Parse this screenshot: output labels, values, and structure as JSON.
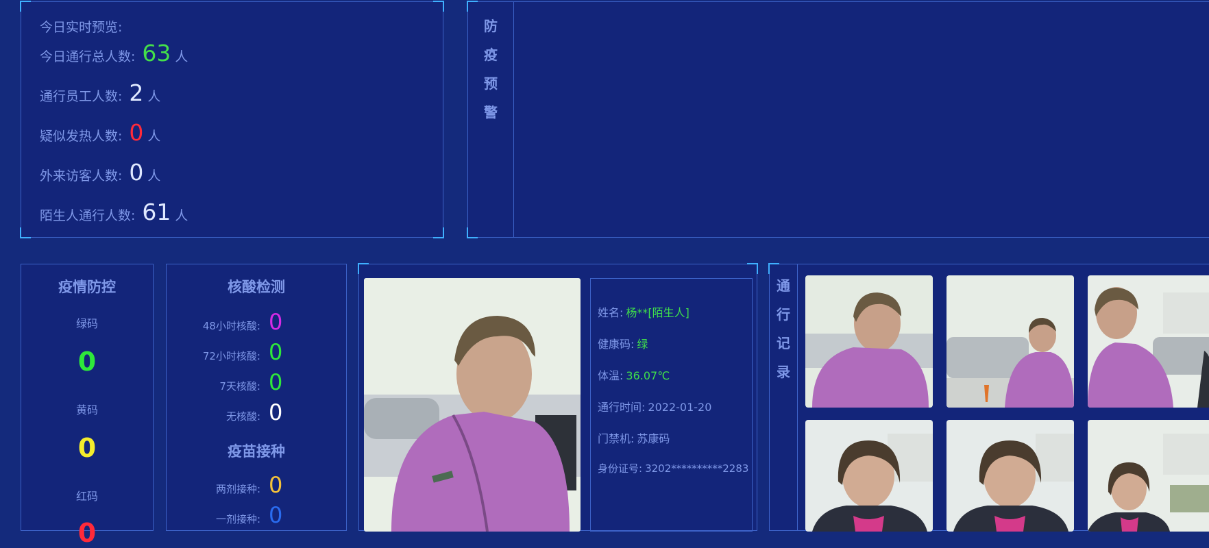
{
  "stats": {
    "title": "今日实时预览:",
    "rows": [
      {
        "label": "今日通行总人数:",
        "value": "63",
        "unit": "人",
        "color": "#44e04a"
      },
      {
        "label": "通行员工人数:",
        "value": "2",
        "unit": "人",
        "color": "#dfe8ff"
      },
      {
        "label": "疑似发热人数:",
        "value": "0",
        "unit": "人",
        "color": "#ff2a3a"
      },
      {
        "label": "外来访客人数:",
        "value": "0",
        "unit": "人",
        "color": "#dfe8ff"
      },
      {
        "label": "陌生人通行人数:",
        "value": "61",
        "unit": "人",
        "color": "#dfe8ff"
      }
    ]
  },
  "warning": {
    "title_chars": [
      "防",
      "疫",
      "预",
      "警"
    ]
  },
  "epidemic": {
    "title": "疫情防控",
    "codes": [
      {
        "label": "绿码",
        "value": "0",
        "color": "#2ee83a"
      },
      {
        "label": "黄码",
        "value": "0",
        "color": "#f4ec2c"
      },
      {
        "label": "红码",
        "value": "0",
        "color": "#ff2a3a"
      }
    ]
  },
  "nucleic": {
    "title": "核酸检测",
    "rows": [
      {
        "label": "48小时核酸:",
        "value": "0",
        "color": "#d62ae6"
      },
      {
        "label": "72小时核酸:",
        "value": "0",
        "color": "#2ee83a"
      },
      {
        "label": "7天核酸:",
        "value": "0",
        "color": "#2ee83a"
      },
      {
        "label": "无核酸:",
        "value": "0",
        "color": "#ffffff"
      }
    ],
    "vaccine_title": "疫苗接种",
    "vaccine_rows": [
      {
        "label": "两剂接种:",
        "value": "0",
        "color": "#f4c23a"
      },
      {
        "label": "一剂接种:",
        "value": "0",
        "color": "#2a6cf0"
      }
    ]
  },
  "person": {
    "fields": [
      {
        "label": "姓名:",
        "value": "杨**[陌生人]",
        "color": "#3fe04a"
      },
      {
        "label": "健康码:",
        "value": "绿",
        "color": "#3fe04a"
      },
      {
        "label": "体温:",
        "value": "36.07℃",
        "color": "#3fe04a"
      },
      {
        "label": "通行时间:",
        "value": "2022-01-20",
        "color": "#7f98e8"
      },
      {
        "label": "门禁机:",
        "value": "苏康码",
        "color": "#7f98e8"
      },
      {
        "label": "身份证号:",
        "value": "3202**********2283",
        "color": "#7f98e8"
      }
    ]
  },
  "records": {
    "title_chars": [
      "通",
      "行",
      "记",
      "录"
    ]
  }
}
